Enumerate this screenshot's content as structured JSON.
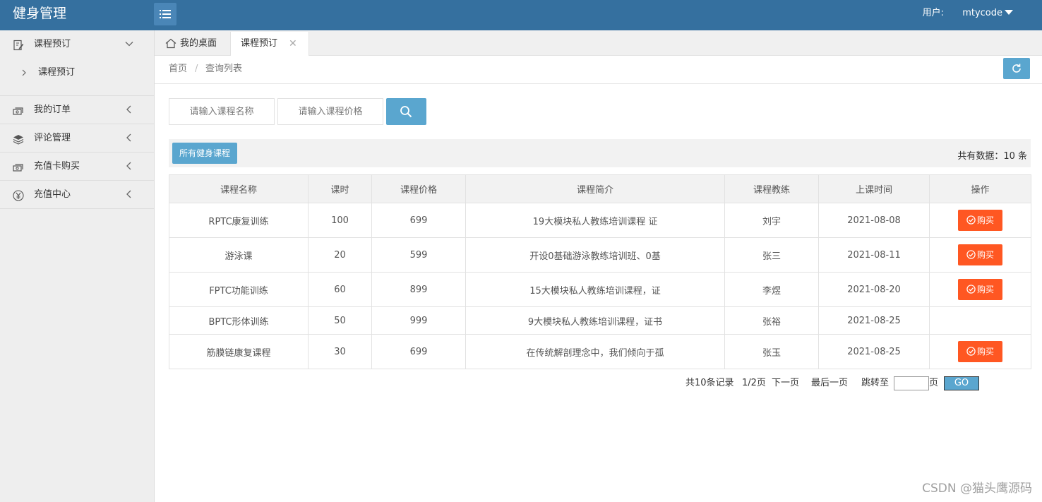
{
  "header": {
    "app_title": "健身管理",
    "user_label": "用户:",
    "username": "mtycode"
  },
  "sidebar": {
    "items": [
      {
        "label": "课程预订",
        "icon": "edit-doc-icon",
        "expanded": true,
        "children": [
          {
            "label": "课程预订"
          }
        ]
      },
      {
        "label": "我的订单",
        "icon": "cash-icon"
      },
      {
        "label": "评论管理",
        "icon": "layers-icon"
      },
      {
        "label": "充值卡购买",
        "icon": "cash-icon"
      },
      {
        "label": "充值中心",
        "icon": "yen-icon"
      }
    ]
  },
  "tabs": {
    "home_label": "我的桌面",
    "active_label": "课程预订",
    "close_symbol": "✕"
  },
  "breadcrumb": {
    "home": "首页",
    "separator": "/",
    "current": "查询列表"
  },
  "search": {
    "name_placeholder": "请输入课程名称",
    "price_placeholder": "请输入课程价格"
  },
  "toolbar": {
    "all_courses_label": "所有健身课程",
    "total_count": "共有数据：10 条"
  },
  "table": {
    "columns": [
      "课程名称",
      "课时",
      "课程价格",
      "课程简介",
      "课程教练",
      "上课时间",
      "操作"
    ],
    "rows": [
      {
        "name": "RPTC康复训练",
        "hours": "100",
        "price": "699",
        "intro": "19大模块私人教练培训课程 证",
        "coach": "刘宇",
        "time": "2021-08-08",
        "action": "购买"
      },
      {
        "name": "游泳课",
        "hours": "20",
        "price": "599",
        "intro": "开设0基础游泳教练培训班、0基",
        "coach": "张三",
        "time": "2021-08-11",
        "action": "购买"
      },
      {
        "name": "FPTC功能训练",
        "hours": "60",
        "price": "899",
        "intro": "15大模块私人教练培训课程，证",
        "coach": "李煜",
        "time": "2021-08-20",
        "action": "购买"
      },
      {
        "name": "BPTC形体训练",
        "hours": "50",
        "price": "999",
        "intro": "9大模块私人教练培训课程，证书",
        "coach": "张裕",
        "time": "2021-08-25",
        "action": ""
      },
      {
        "name": "筋膜链康复课程",
        "hours": "30",
        "price": "699",
        "intro": "在传统解剖理念中，我们倾向于孤",
        "coach": "张玉",
        "time": "2021-08-25",
        "action": "购买"
      }
    ]
  },
  "pager": {
    "records": "共10条记录",
    "page": "1/2页",
    "next": "下一页",
    "last": "最后一页",
    "jump_label": "跳转至",
    "page_unit": "页",
    "go": "GO"
  },
  "watermark": "CSDN @猫头鹰源码",
  "colors": {
    "header_bg": "#35709f",
    "primary_button": "#5aa6cf",
    "buy_button": "#ff5722",
    "sidebar_bg": "#eeeeee"
  }
}
